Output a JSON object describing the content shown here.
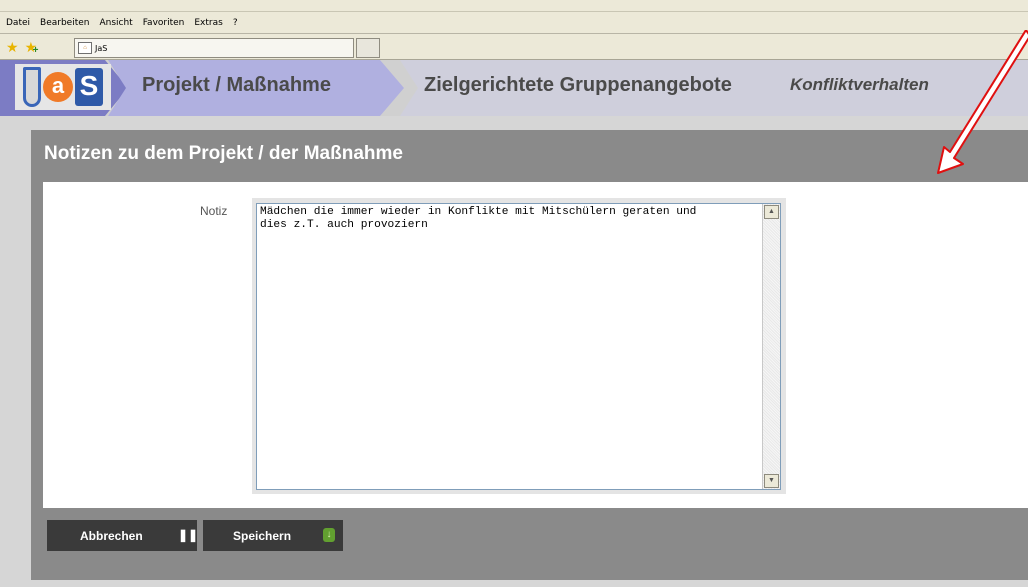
{
  "browser": {
    "menu": [
      "Datei",
      "Bearbeiten",
      "Ansicht",
      "Favoriten",
      "Extras",
      "?"
    ],
    "tab_title": "JaS",
    "icons": [
      "favorites-star-icon",
      "add-favorite-icon",
      "tab-favicon"
    ]
  },
  "header": {
    "logo_text": "JaS",
    "logo_letters": [
      "J",
      "a",
      "S"
    ],
    "breadcrumb_project": "Projekt / Maßnahme",
    "breadcrumb_offer": "Zielgerichtete Gruppenangebote",
    "breadcrumb_sub": "Konfliktverhalten"
  },
  "panel": {
    "title": "Notizen zu dem Projekt / der Maßnahme"
  },
  "form": {
    "notiz_label": "Notiz",
    "notiz_value": "Mädchen die immer wieder in Konflikte mit Mitschülern geraten und\ndies z.T. auch provoziern"
  },
  "buttons": {
    "cancel_label": "Abbrechen",
    "save_label": "Speichern"
  },
  "colors": {
    "header_breadcrumb_active": "#7c7cc4",
    "panel": "#8a8a8a",
    "button": "#3a3a3a",
    "annotation_arrow": "#e01010"
  }
}
